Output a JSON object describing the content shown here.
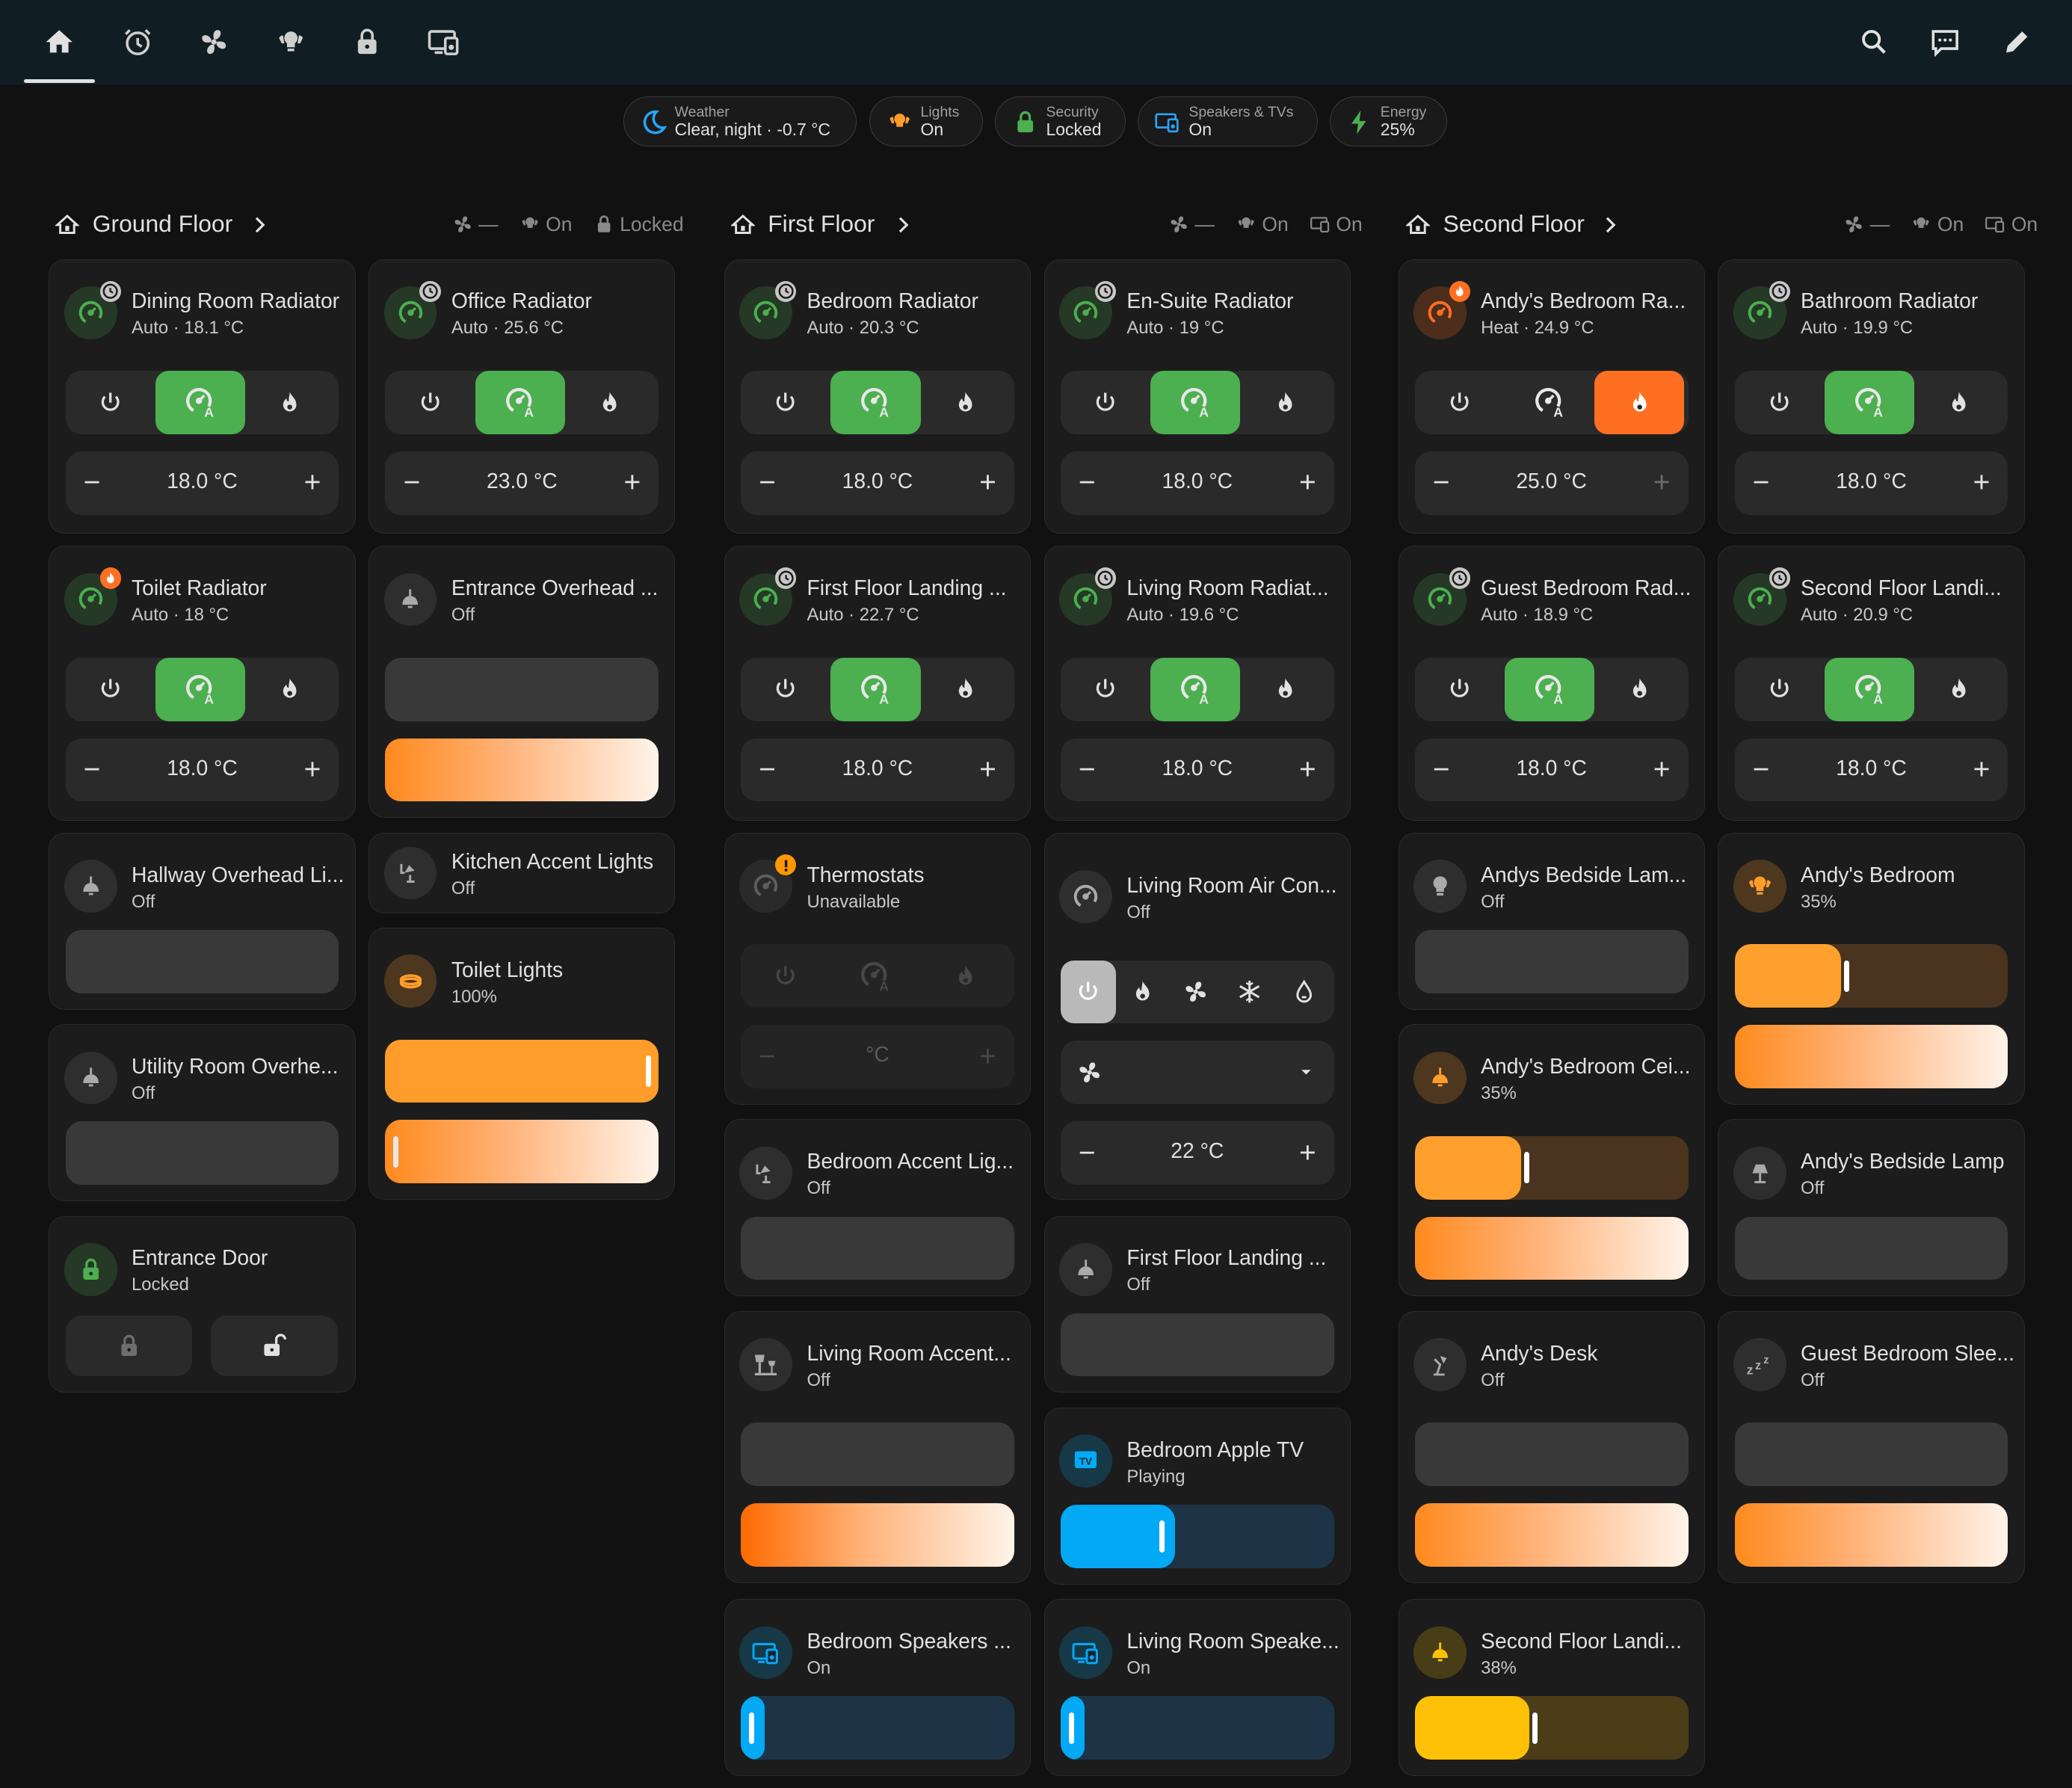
{
  "nav": {
    "tabs": [
      {
        "icon": "home-icon",
        "active": true
      },
      {
        "icon": "alarm-clock-icon"
      },
      {
        "icon": "fan-icon"
      },
      {
        "icon": "lightbulb-group-icon"
      },
      {
        "icon": "lock-icon"
      },
      {
        "icon": "speaker-tv-icon"
      }
    ],
    "actions": [
      "search-icon",
      "assist-chat-icon",
      "edit-pencil-icon"
    ]
  },
  "summary": {
    "weather": {
      "label": "Weather",
      "value": "Clear, night · -0.7 °C"
    },
    "lights": {
      "label": "Lights",
      "value": "On"
    },
    "security": {
      "label": "Security",
      "value": "Locked"
    },
    "media": {
      "label": "Speakers & TVs",
      "value": "On"
    },
    "energy": {
      "label": "Energy",
      "value": "25%"
    }
  },
  "colors": {
    "heat_orange": "#ff6f22",
    "auto_green": "#4caf50",
    "light_amber": "#ff9d2a",
    "media_blue": "#03a9f4",
    "warning": "#ff9800",
    "background": "#111111",
    "card": "#1c1c1c"
  },
  "areas": {
    "ground": {
      "title": "Ground Floor",
      "badges": {
        "fan": "—",
        "lights": "On",
        "lock": "Locked"
      },
      "cards": {
        "dining_radiator": {
          "name": "Dining Room Radiator",
          "state": "Auto · 18.1 °C",
          "target": "18.0 °C",
          "mode": "auto"
        },
        "office_radiator": {
          "name": "Office Radiator",
          "state": "Auto · 25.6 °C",
          "target": "23.0 °C",
          "mode": "auto"
        },
        "toilet_radiator": {
          "name": "Toilet Radiator",
          "state": "Auto · 18 °C",
          "target": "18.0 °C",
          "mode": "auto",
          "heating": true
        },
        "entrance_overhead": {
          "name": "Entrance Overhead ...",
          "state": "Off",
          "brightness": 0
        },
        "hallway_overhead": {
          "name": "Hallway Overhead Li...",
          "state": "Off",
          "brightness": 0
        },
        "kitchen_accent": {
          "name": "Kitchen Accent Lights",
          "state": "Off"
        },
        "toilet_lights": {
          "name": "Toilet Lights",
          "state": "100%",
          "brightness": 1.0,
          "color_temp": 0.02
        },
        "utility_overhead": {
          "name": "Utility Room Overhe...",
          "state": "Off",
          "brightness": 0
        },
        "entrance_door": {
          "name": "Entrance Door",
          "state": "Locked"
        }
      }
    },
    "first": {
      "title": "First Floor",
      "badges": {
        "fan": "—",
        "lights": "On",
        "media": "On"
      },
      "cards": {
        "bedroom_radiator": {
          "name": "Bedroom Radiator",
          "state": "Auto · 20.3 °C",
          "target": "18.0 °C",
          "mode": "auto"
        },
        "ensuite_radiator": {
          "name": "En-Suite Radiator",
          "state": "Auto · 19 °C",
          "target": "18.0 °C",
          "mode": "auto"
        },
        "ff_landing_radiator": {
          "name": "First Floor Landing ...",
          "state": "Auto · 22.7 °C",
          "target": "18.0 °C",
          "mode": "auto"
        },
        "living_radiator": {
          "name": "Living Room Radiat...",
          "state": "Auto · 19.6 °C",
          "target": "18.0 °C",
          "mode": "auto"
        },
        "thermostats": {
          "name": "Thermostats",
          "state": "Unavailable",
          "target": "°C"
        },
        "living_ac": {
          "name": "Living Room Air Con...",
          "state": "Off",
          "target": "22 °C"
        },
        "bedroom_accent": {
          "name": "Bedroom Accent Lig...",
          "state": "Off",
          "brightness": 0
        },
        "ff_landing_light": {
          "name": "First Floor Landing ...",
          "state": "Off",
          "brightness": 0
        },
        "living_accent": {
          "name": "Living Room Accent...",
          "state": "Off",
          "brightness": 0
        },
        "apple_tv": {
          "name": "Bedroom Apple TV",
          "state": "Playing",
          "tv_label": "TV",
          "volume": 0.37
        },
        "bedroom_speakers": {
          "name": "Bedroom Speakers ...",
          "state": "On",
          "volume": 0.04
        },
        "living_speakers": {
          "name": "Living Room Speake...",
          "state": "On",
          "volume": 0.04
        }
      }
    },
    "second": {
      "title": "Second Floor",
      "badges": {
        "fan": "—",
        "lights": "On",
        "media": "On"
      },
      "cards": {
        "andys_radiator": {
          "name": "Andy's Bedroom Ra...",
          "state": "Heat · 24.9 °C",
          "target": "25.0 °C",
          "mode": "heat"
        },
        "bathroom_radiator": {
          "name": "Bathroom Radiator",
          "state": "Auto · 19.9 °C",
          "target": "18.0 °C",
          "mode": "auto"
        },
        "guest_radiator": {
          "name": "Guest Bedroom Rad...",
          "state": "Auto · 18.9 °C",
          "target": "18.0 °C",
          "mode": "auto"
        },
        "sf_landing_radiator": {
          "name": "Second Floor Landi...",
          "state": "Auto · 20.9 °C",
          "target": "18.0 °C",
          "mode": "auto"
        },
        "andys_bedside_lamp_1": {
          "name": "Andys Bedside Lam...",
          "state": "Off",
          "brightness": 0
        },
        "andys_bedroom_group": {
          "name": "Andy's Bedroom",
          "state": "35%",
          "brightness": 0.35
        },
        "andys_ceiling": {
          "name": "Andy's Bedroom Cei...",
          "state": "35%",
          "brightness": 0.35
        },
        "andys_bedside_lamp_2": {
          "name": "Andy's Bedside Lamp",
          "state": "Off",
          "brightness": 0
        },
        "andys_desk": {
          "name": "Andy's Desk",
          "state": "Off",
          "brightness": 0
        },
        "guest_sleep": {
          "name": "Guest Bedroom Slee...",
          "state": "Off",
          "brightness": 0,
          "icon_text": "zzz"
        },
        "sf_landing_light": {
          "name": "Second Floor Landi...",
          "state": "38%",
          "brightness": 0.38
        }
      }
    }
  }
}
